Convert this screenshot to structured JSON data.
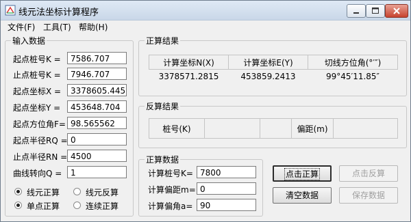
{
  "window": {
    "title": "线元法坐标计算程序"
  },
  "menu": [
    "文件(F)",
    "工具(T)",
    "帮助(H)"
  ],
  "input": {
    "legend": "输入数据",
    "fields": [
      {
        "label": "起点桩号K =",
        "value": "7586.707"
      },
      {
        "label": "止点桩号K =",
        "value": "7946.707"
      },
      {
        "label": "起点坐标X =",
        "value": "3378605.445"
      },
      {
        "label": "起点坐标Y =",
        "value": "453648.704"
      },
      {
        "label": "起点方位角F=",
        "value": "98.565562"
      },
      {
        "label": "起点半径RQ =",
        "value": "0"
      },
      {
        "label": "止点半径RN =",
        "value": "4500"
      },
      {
        "label": "曲线转向Q =",
        "value": "1"
      }
    ],
    "options": [
      {
        "label": "线元正算",
        "checked": true
      },
      {
        "label": "线元反算",
        "checked": false
      },
      {
        "label": "单点正算",
        "checked": true
      },
      {
        "label": "连续正算",
        "checked": false
      }
    ]
  },
  "forward": {
    "legend": "正算结果",
    "headers": [
      "计算坐标N(X)",
      "计算坐标E(Y)",
      "切线方位角(°′″)"
    ],
    "values": [
      "3378571.2815",
      "453859.2413",
      "99°45′11.85″"
    ]
  },
  "reverse": {
    "legend": "反算结果",
    "labels": [
      "桩号(K)",
      "偏距(m)"
    ]
  },
  "calc": {
    "legend": "正算数据",
    "fields": [
      {
        "label": "计算桩号K=",
        "value": "7800"
      },
      {
        "label": "计算偏距m=",
        "value": "0"
      },
      {
        "label": "计算偏角a=",
        "value": "90"
      }
    ]
  },
  "buttons": {
    "forward_calc": "点击正算",
    "reverse_calc": "点击反算",
    "clear": "清空数据",
    "save": "保存数据"
  }
}
